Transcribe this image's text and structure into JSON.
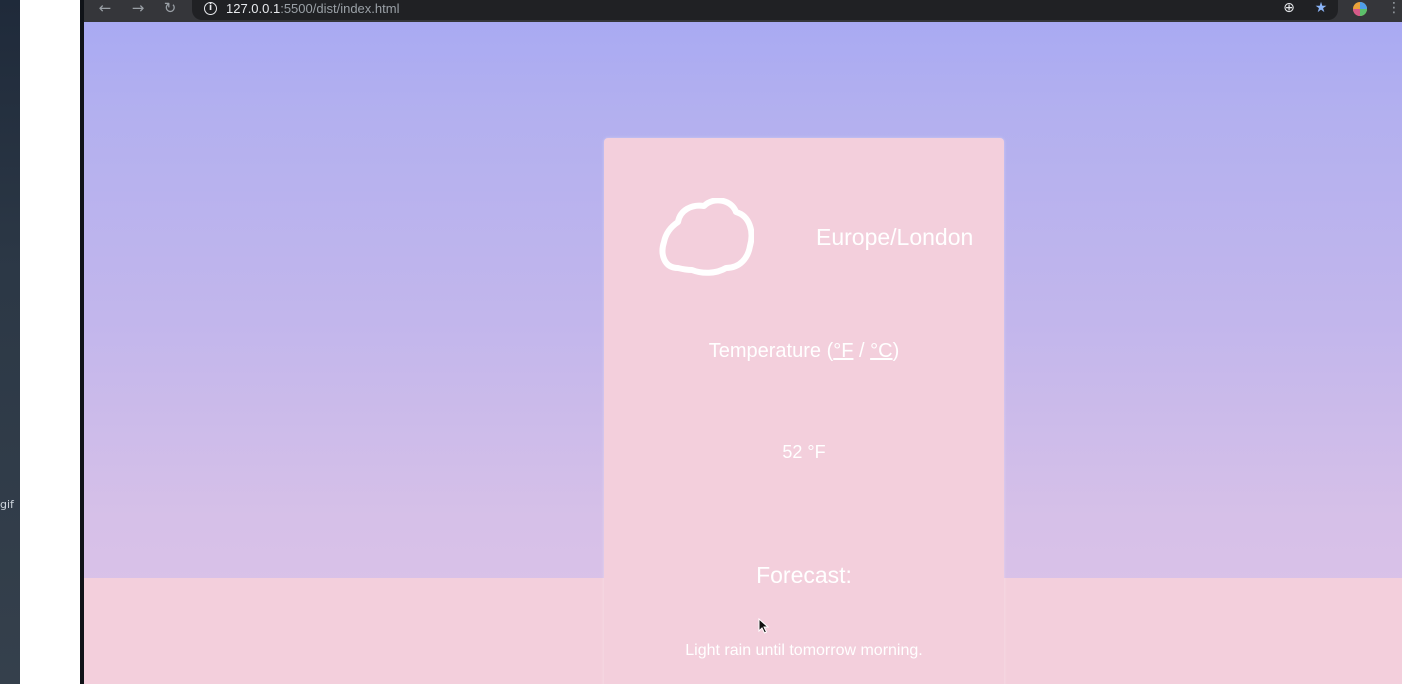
{
  "desktop": {
    "side_label": "gif"
  },
  "browser": {
    "back_icon": "arrow-left-icon",
    "forward_icon": "arrow-right-icon",
    "reload_icon": "reload-icon",
    "url_host": "127.0.0.1",
    "url_path": ":5500/dist/index.html",
    "extension_icon": "target-extension-icon",
    "bookmark_icon": "star-icon",
    "profile_icon": "color-wheel-icon",
    "menu_icon": "kebab-menu-icon"
  },
  "weather": {
    "icon": "cloud-icon",
    "location": "Europe/London",
    "temp_label": "Temperature (",
    "unit_f": "°F",
    "unit_sep": " / ",
    "unit_c": "°C",
    "temp_close": ")",
    "temp_value": "52 °F",
    "forecast_heading": "Forecast:",
    "forecast_text": "Light rain until tomorrow morning."
  },
  "colors": {
    "page_top": "#a9aaf3",
    "page_bottom": "#dec4e7",
    "card_background": "#f3cfdc",
    "text": "#ffffff",
    "chrome_toolbar": "#35363a",
    "omnibox": "#202124"
  }
}
